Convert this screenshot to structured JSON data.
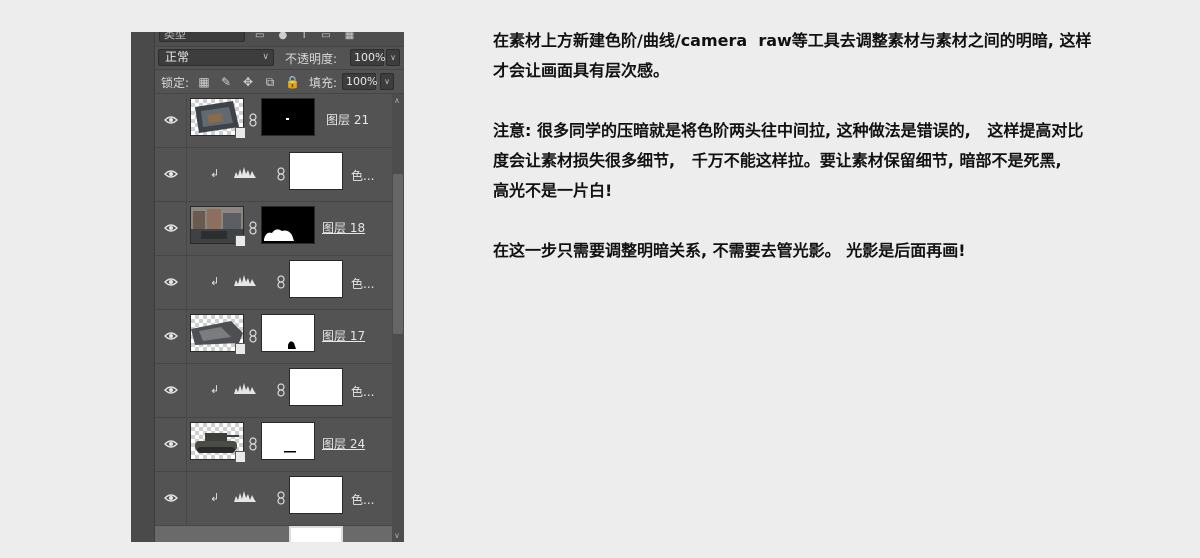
{
  "panel": {
    "filter_label": "类型",
    "blend_mode": "正常",
    "opacity_label": "不透明度:",
    "opacity_value": "100%",
    "lock_label": "锁定:",
    "fill_label": "填充:",
    "fill_value": "100%"
  },
  "layers": [
    {
      "kind": "pixel",
      "name": "图层 21",
      "thumb": "checker",
      "mask": "black",
      "underlined": false
    },
    {
      "kind": "adjustment",
      "name": "色...",
      "mask": "white"
    },
    {
      "kind": "pixel",
      "name": "图层 18",
      "thumb": "photo",
      "mask": "black",
      "underlined": true
    },
    {
      "kind": "adjustment",
      "name": "色...",
      "mask": "white"
    },
    {
      "kind": "pixel",
      "name": "图层 17",
      "thumb": "checker",
      "mask": "white",
      "underlined": true
    },
    {
      "kind": "adjustment",
      "name": "色...",
      "mask": "white"
    },
    {
      "kind": "pixel",
      "name": "图层 24",
      "thumb": "checker",
      "mask": "white",
      "underlined": true
    },
    {
      "kind": "adjustment",
      "name": "色...",
      "mask": "white"
    }
  ],
  "notes": {
    "p1": "在素材上方新建色阶/曲线/camera  raw等工具去调整素材与素材之间的明暗, 这样才会让画面具有层次感。",
    "p2": "注意: 很多同学的压暗就是将色阶两头往中间拉, 这种做法是错误的,   这样提高对比度会让素材损失很多细节,   千万不能这样拉。要让素材保留细节, 暗部不是死黑,   高光不是一片白!",
    "p3": "在这一步只需要调整明暗关系, 不需要去管光影。 光影是后面再画!"
  }
}
